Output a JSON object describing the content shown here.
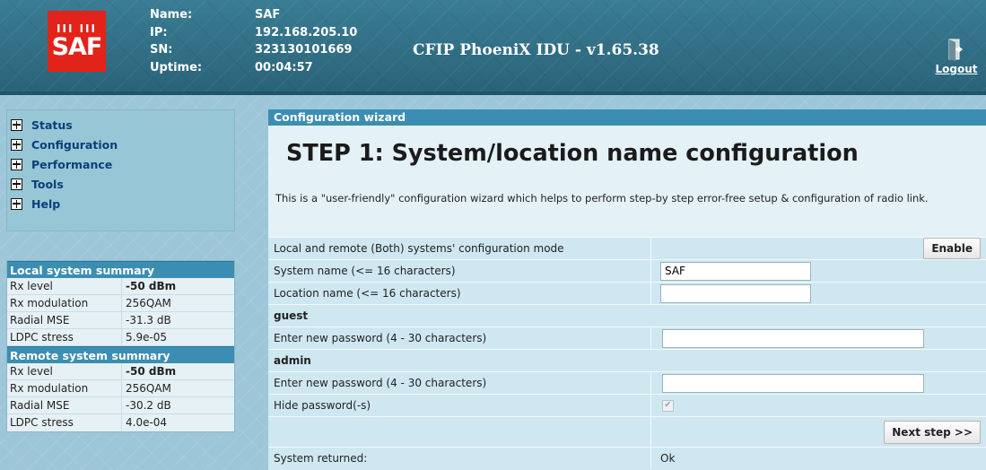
{
  "header": {
    "logo_text": "SAF",
    "labels": {
      "name": "Name:",
      "ip": "IP:",
      "sn": "SN:",
      "uptime": "Uptime:"
    },
    "values": {
      "name": "SAF",
      "ip": "192.168.205.10",
      "sn": "323130101669",
      "uptime": "00:04:57"
    },
    "title": "CFIP PhoeniX IDU - v1.65.38",
    "logout": "Logout"
  },
  "menu": {
    "items": [
      {
        "label": "Status"
      },
      {
        "label": "Configuration"
      },
      {
        "label": "Performance"
      },
      {
        "label": "Tools"
      },
      {
        "label": "Help"
      }
    ]
  },
  "local_summary": {
    "title": "Local system summary",
    "rows": [
      {
        "key": "Rx level",
        "value": "-50 dBm"
      },
      {
        "key": "Rx modulation",
        "value": "256QAM"
      },
      {
        "key": "Radial MSE",
        "value": "-31.3 dB"
      },
      {
        "key": "LDPC stress",
        "value": "5.9e-05"
      }
    ]
  },
  "remote_summary": {
    "title": "Remote system summary",
    "rows": [
      {
        "key": "Rx level",
        "value": "-50 dBm"
      },
      {
        "key": "Rx modulation",
        "value": "256QAM"
      },
      {
        "key": "Radial MSE",
        "value": "-30.2 dB"
      },
      {
        "key": "LDPC stress",
        "value": "4.0e-04"
      }
    ]
  },
  "wizard": {
    "panel_title": "Configuration wizard",
    "heading": "STEP 1: System/location name configuration",
    "description": "This is a \"user-friendly\" configuration wizard which helps to perform step-by step error-free setup & configuration of radio link.",
    "mode_label": "Local and remote (Both) systems' configuration mode",
    "enable_button": "Enable",
    "system_name_label": "System name (<= 16 characters)",
    "system_name_value": "SAF",
    "location_name_label": "Location name (<= 16 characters)",
    "location_name_value": "",
    "guest_section": "guest",
    "guest_password_label": "Enter new password (4 - 30 characters)",
    "admin_section": "admin",
    "admin_password_label": "Enter new password (4 - 30 characters)",
    "hide_password_label": "Hide password(-s)",
    "hide_password_checked": true,
    "next_button": "Next step >>",
    "system_returned_label": "System returned:",
    "system_returned_value": "Ok"
  }
}
